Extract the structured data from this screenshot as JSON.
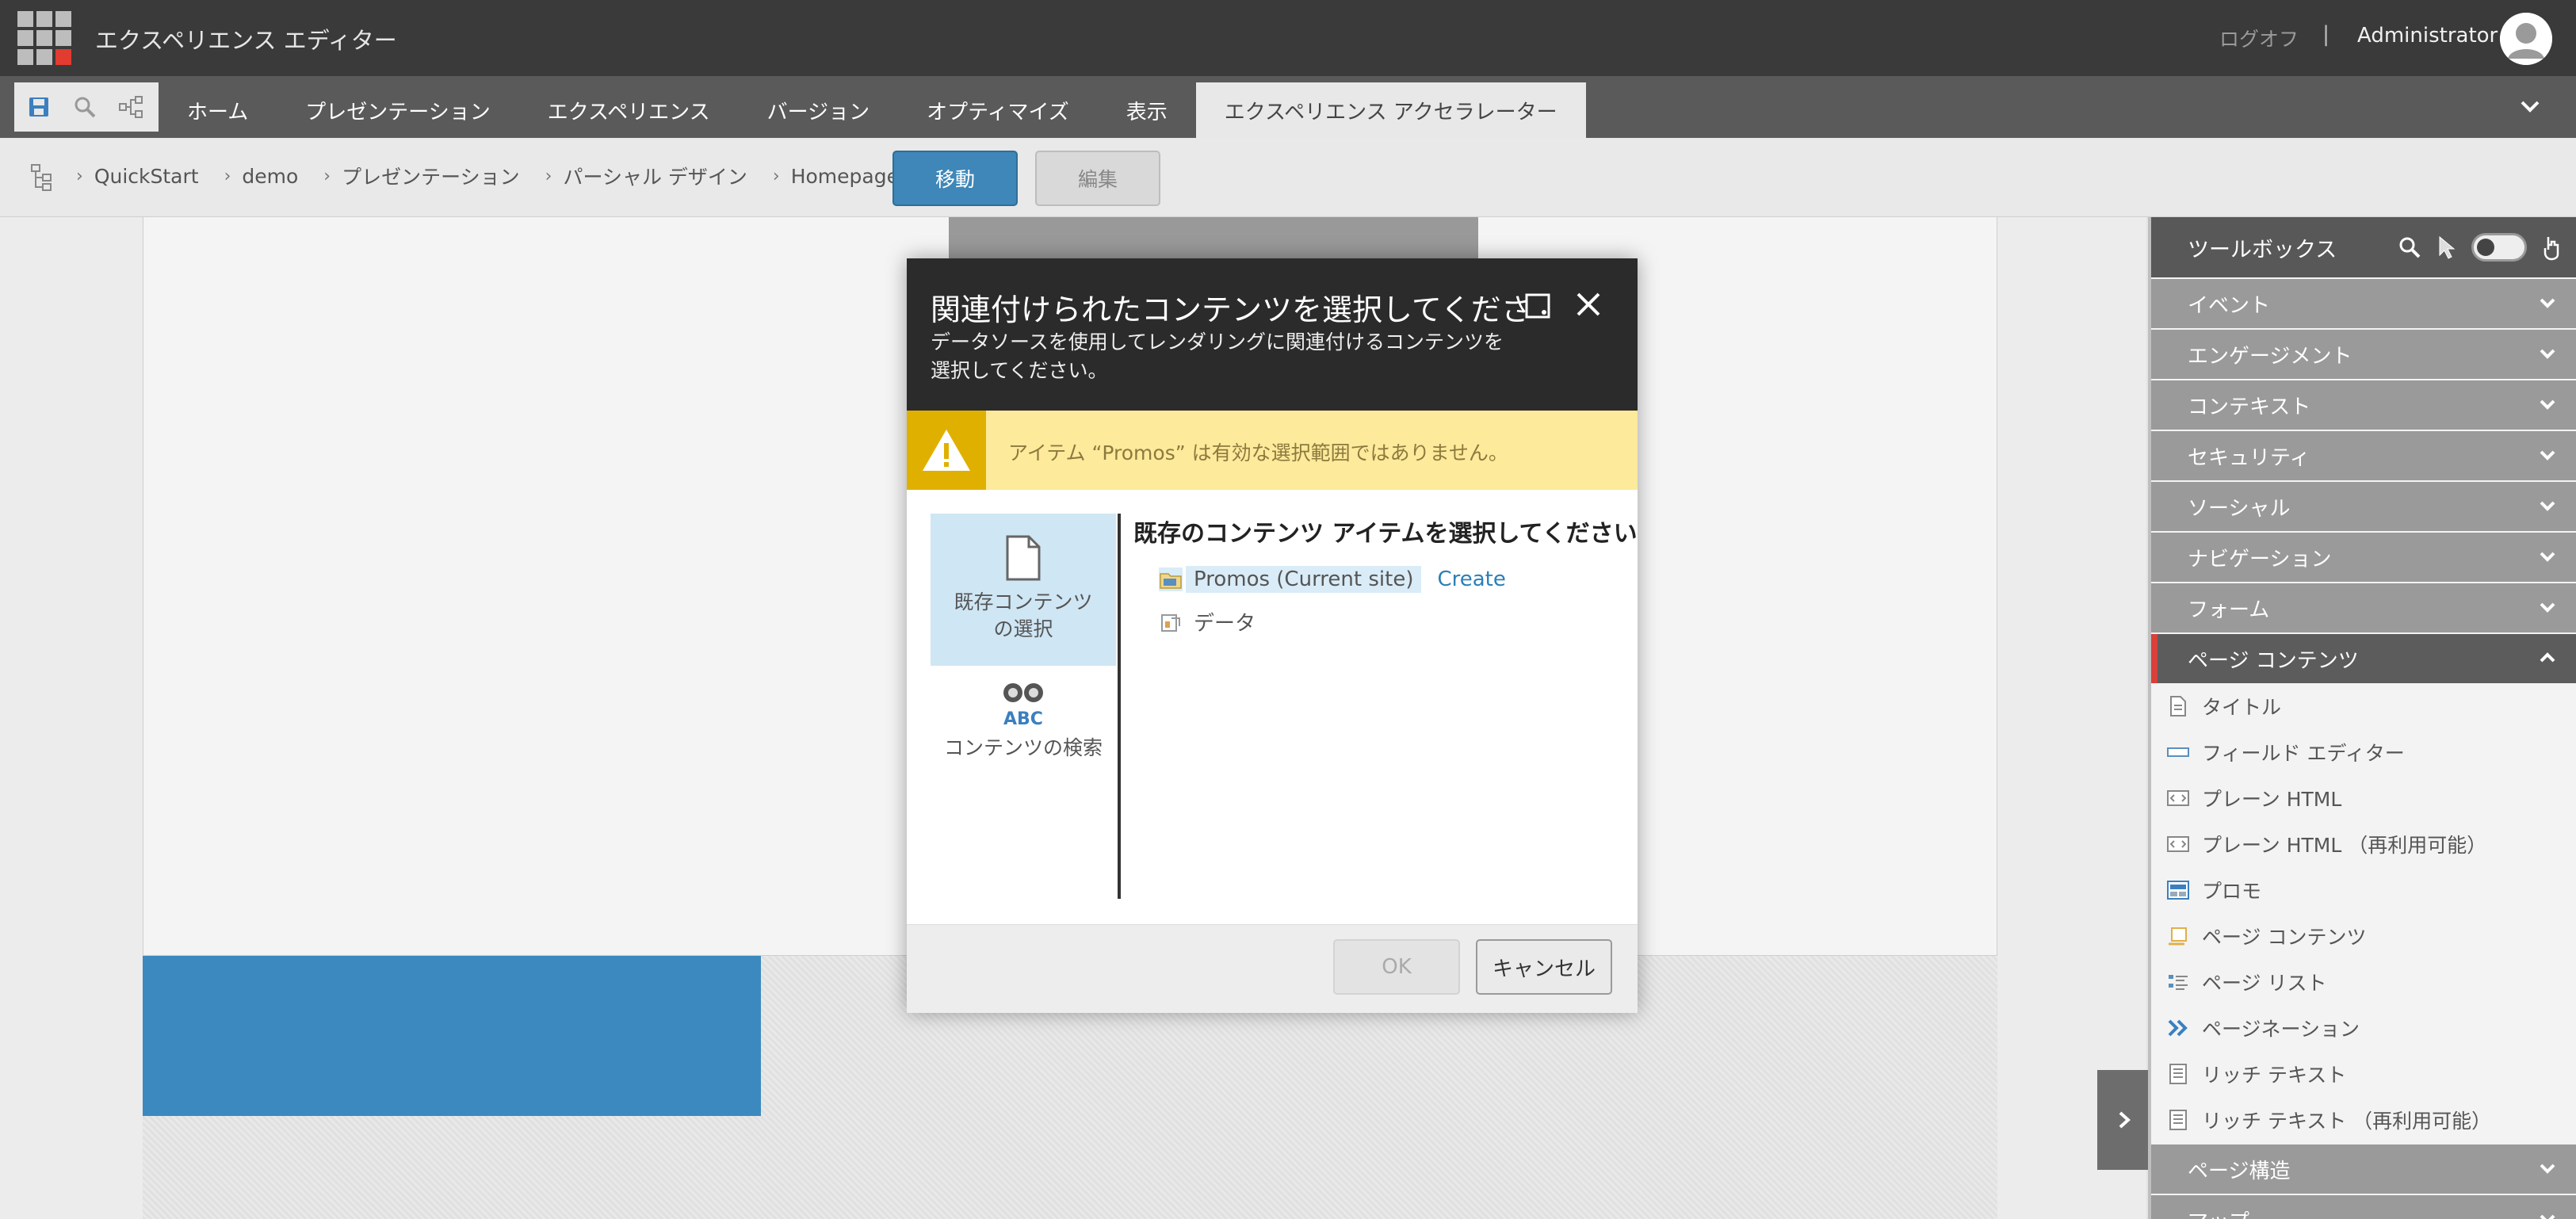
{
  "app": {
    "title": "エクスペリエンス エディター",
    "logoff": "ログオフ",
    "separator": "|",
    "user": "Administrator"
  },
  "ribbon": {
    "tabs": [
      {
        "label": "ホーム"
      },
      {
        "label": "プレゼンテーション"
      },
      {
        "label": "エクスペリエンス"
      },
      {
        "label": "バージョン"
      },
      {
        "label": "オプティマイズ"
      },
      {
        "label": "表示"
      },
      {
        "label": "エクスペリエンス アクセラレーター"
      }
    ],
    "active_tab": "エクスペリエンス アクセラレーター"
  },
  "breadcrumb": {
    "items": [
      "QuickStart",
      "demo",
      "プレゼンテーション",
      "パーシャル デザイン",
      "Homepage"
    ],
    "go_label": "移動",
    "edit_label": "編集"
  },
  "toolbox": {
    "title": "ツールボックス",
    "sections": [
      {
        "label": "イベント",
        "open": false
      },
      {
        "label": "エンゲージメント",
        "open": false
      },
      {
        "label": "コンテキスト",
        "open": false
      },
      {
        "label": "セキュリティ",
        "open": false
      },
      {
        "label": "ソーシャル",
        "open": false
      },
      {
        "label": "ナビゲーション",
        "open": false
      },
      {
        "label": "フォーム",
        "open": false
      },
      {
        "label": "ページ コンテンツ",
        "open": true
      }
    ],
    "items": [
      {
        "label": "タイトル",
        "icon": "document-icon"
      },
      {
        "label": "フィールド エディター",
        "icon": "field-icon"
      },
      {
        "label": "プレーン HTML",
        "icon": "html-icon"
      },
      {
        "label": "プレーン HTML （再利用可能）",
        "icon": "html-icon"
      },
      {
        "label": "プロモ",
        "icon": "promo-icon"
      },
      {
        "label": "ページ コンテンツ",
        "icon": "page-content-icon"
      },
      {
        "label": "ページ リスト",
        "icon": "list-icon"
      },
      {
        "label": "ページネーション",
        "icon": "double-chevron-icon"
      },
      {
        "label": "リッチ テキスト",
        "icon": "rich-text-icon"
      },
      {
        "label": "リッチ テキスト （再利用可能）",
        "icon": "rich-text-icon"
      }
    ],
    "after_sections": [
      {
        "label": "ページ構造",
        "open": false
      },
      {
        "label": "マップ",
        "open": false
      }
    ]
  },
  "dialog": {
    "title": "関連付けられたコンテンツを選択してください",
    "subtitle": "データソースを使用してレンダリングに関連付けるコンテンツを選択してください。",
    "warning": "アイテム “Promos” は有効な選択範囲ではありません。",
    "nav": [
      {
        "label": "既存コンテンツの選択",
        "selected": true,
        "icon": "document-icon"
      },
      {
        "label": "コンテンツの検索",
        "selected": false,
        "icon": "binoculars-icon"
      }
    ],
    "pane_title": "既存のコンテンツ アイテムを選択してください",
    "tree": [
      {
        "label": "Promos (Current site)",
        "highlighted": true,
        "action": "Create",
        "icon": "folder-icon"
      },
      {
        "label": "データ",
        "highlighted": false,
        "icon": "data-folder-icon"
      }
    ],
    "ok_label": "OK",
    "cancel_label": "キャンセル"
  },
  "colors": {
    "accent": "#3e87b8",
    "warning_bg": "#fdea9b",
    "warning_icon": "#e0b000",
    "active_section_marker": "#d9403a"
  }
}
